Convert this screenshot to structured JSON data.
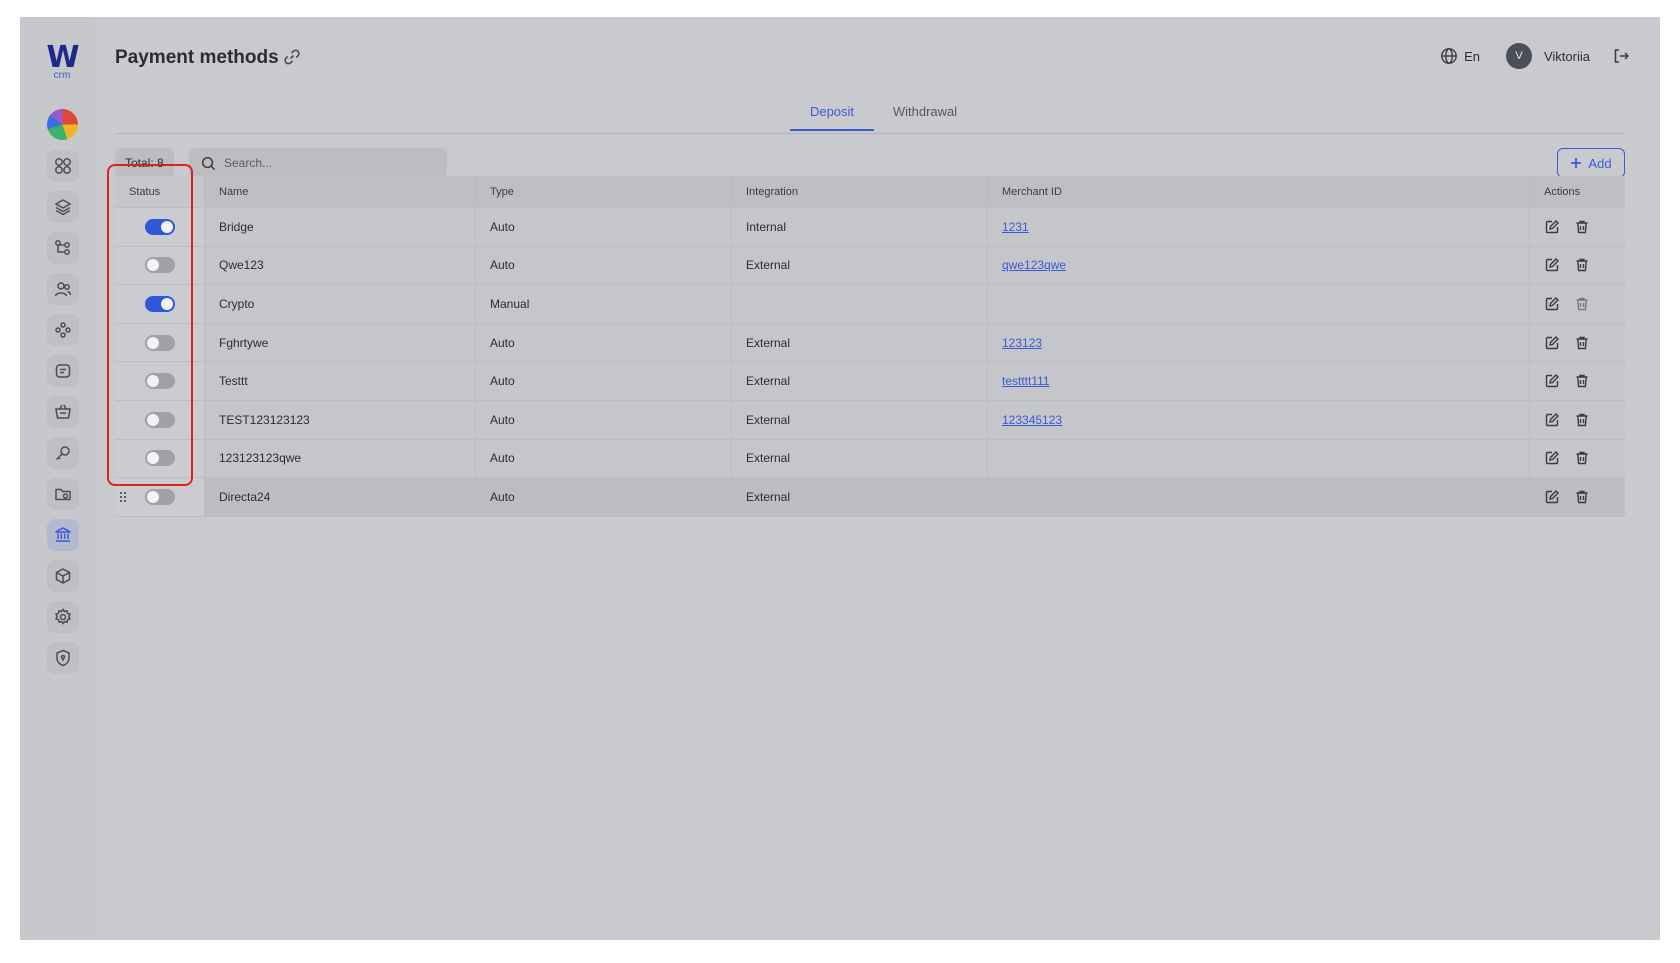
{
  "app": {
    "logo_text": "W",
    "logo_sub": "crm"
  },
  "sidebar": {
    "items": [
      {
        "icon": "dashboard-icon"
      },
      {
        "icon": "layers-icon"
      },
      {
        "icon": "hierarchy-icon"
      },
      {
        "icon": "users-icon"
      },
      {
        "icon": "groups-icon"
      },
      {
        "icon": "tickets-icon"
      },
      {
        "icon": "basket-icon"
      },
      {
        "icon": "key-icon"
      },
      {
        "icon": "folder-icon"
      },
      {
        "icon": "bank-icon",
        "active": true
      },
      {
        "icon": "box-icon"
      },
      {
        "icon": "settings-icon"
      },
      {
        "icon": "shield-icon"
      }
    ]
  },
  "header": {
    "title": "Payment methods",
    "language": "En",
    "avatar_letter": "V",
    "user_name": "Viktoriia"
  },
  "tabs": [
    {
      "label": "Deposit",
      "active": true
    },
    {
      "label": "Withdrawal",
      "active": false
    }
  ],
  "toolbar": {
    "total_label": "Total: 8",
    "search_placeholder": "Search...",
    "add_label": "Add"
  },
  "table": {
    "columns": [
      "Status",
      "Name",
      "Type",
      "Integration",
      "Merchant ID",
      "Actions"
    ],
    "rows": [
      {
        "enabled": true,
        "name": "Bridge",
        "type": "Auto",
        "integration": "Internal",
        "merchant_id": "1231"
      },
      {
        "enabled": false,
        "name": "Qwe123",
        "type": "Auto",
        "integration": "External",
        "merchant_id": "qwe123qwe"
      },
      {
        "enabled": true,
        "name": "Crypto",
        "type": "Manual",
        "integration": "",
        "merchant_id": ""
      },
      {
        "enabled": false,
        "name": "Fghrtywe",
        "type": "Auto",
        "integration": "External",
        "merchant_id": "123123"
      },
      {
        "enabled": false,
        "name": "Testtt",
        "type": "Auto",
        "integration": "External",
        "merchant_id": "testttt111"
      },
      {
        "enabled": false,
        "name": "TEST123123123",
        "type": "Auto",
        "integration": "External",
        "merchant_id": "123345123"
      },
      {
        "enabled": false,
        "name": "123123123qwe",
        "type": "Auto",
        "integration": "External",
        "merchant_id": ""
      },
      {
        "enabled": false,
        "name": "Directa24",
        "type": "Auto",
        "integration": "External",
        "merchant_id": ""
      }
    ]
  },
  "colors": {
    "accent": "#3c5bd6",
    "toggle_on": "#2d58d9",
    "highlight": "#e02020"
  }
}
